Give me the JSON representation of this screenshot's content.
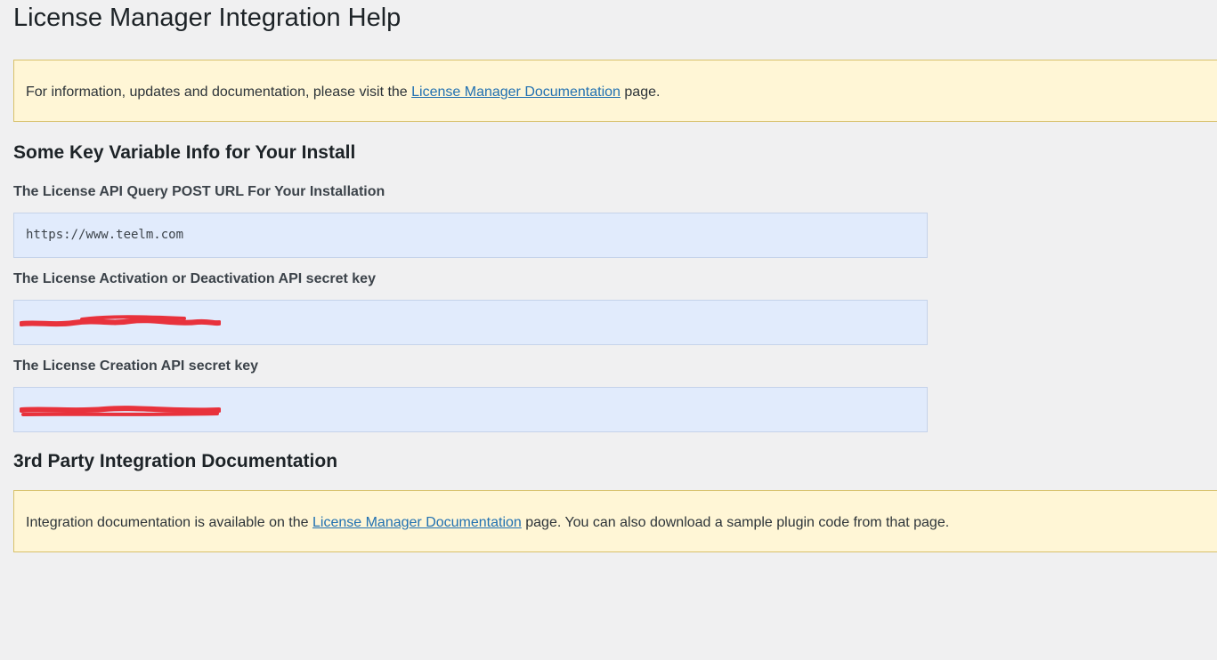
{
  "page": {
    "title": "License Manager Integration Help"
  },
  "notice_top": {
    "text_before": "For information, updates and documentation, please visit the ",
    "link_text": "License Manager Documentation",
    "text_after": " page."
  },
  "key_info": {
    "heading": "Some Key Variable Info for Your Install",
    "fields": [
      {
        "label": "The License API Query POST URL For Your Installation",
        "value": "https://www.teelm.com"
      },
      {
        "label": "The License Activation or Deactivation API secret key",
        "value": ""
      },
      {
        "label": "The License Creation API secret key",
        "value": ""
      }
    ],
    "redaction_color": "#e8323c"
  },
  "integration": {
    "heading": "3rd Party Integration Documentation",
    "text_before": "Integration documentation is available on the ",
    "link_text": "License Manager Documentation",
    "text_after": " page. You can also download a sample plugin code from that page."
  },
  "colors": {
    "background": "#f0f0f1",
    "notice_background": "#fff6d6",
    "notice_border": "#d8c16a",
    "code_background": "#e1ebfc",
    "link": "#2271b1"
  }
}
